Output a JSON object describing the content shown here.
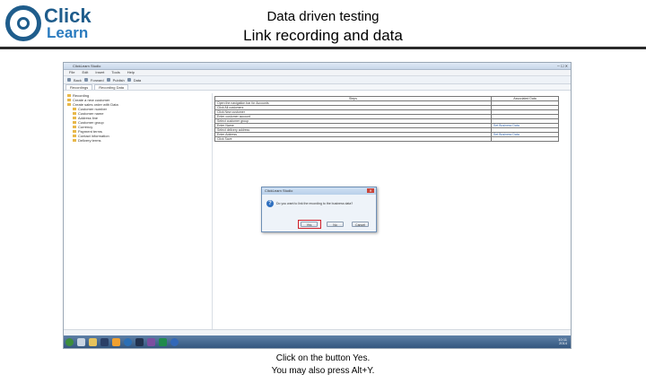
{
  "header": {
    "logo_line1": "Click",
    "logo_line2": "Learn",
    "title_line1": "Data driven testing",
    "title_line2": "Link recording and data"
  },
  "app": {
    "window_title": "ClickLearn Studio",
    "menu": [
      "File",
      "Edit",
      "Insert",
      "Tools",
      "Help"
    ],
    "toolbar_items": [
      "Back",
      "Forward",
      "Publish",
      "Data"
    ],
    "tabs": [
      "Recordings",
      "Recording Data"
    ],
    "tree_items": [
      "Recording",
      "Create a new customer",
      "Create sales order with Data",
      "Customer number",
      "Customer name",
      "Address line",
      "Customer group",
      "Currency",
      "Payment terms",
      "Contact information",
      "Delivery terms"
    ],
    "grid": {
      "headers": [
        "Steps",
        "Associated Data"
      ],
      "rows": [
        [
          "Open the navigation bar for Accounts",
          ""
        ],
        [
          "Click All customers",
          ""
        ],
        [
          "Click New customer",
          ""
        ],
        [
          "Enter customer account",
          ""
        ],
        [
          "Select customer group",
          ""
        ],
        [
          "Enter Name",
          "Set Business Data"
        ],
        [
          "Select delivery address",
          ""
        ],
        [
          "Enter Address",
          "Set Business Data"
        ],
        [
          "Click Save",
          ""
        ]
      ]
    },
    "dialog": {
      "title": "ClickLearn Studio",
      "close_glyph": "✕",
      "icon_glyph": "?",
      "message": "Do you want to link the recording to the business data?",
      "yes_label": "Yes",
      "no_label": "No",
      "cancel_label": "Cancel"
    },
    "clock_time": "10:11",
    "clock_date": "2014"
  },
  "caption": {
    "line1": "Click on the button Yes.",
    "line2": "You may also press Alt+Y."
  },
  "colors": {
    "brand_blue": "#1f5d8c",
    "highlight_red": "#d1202a",
    "taskbar": "#34577f"
  }
}
